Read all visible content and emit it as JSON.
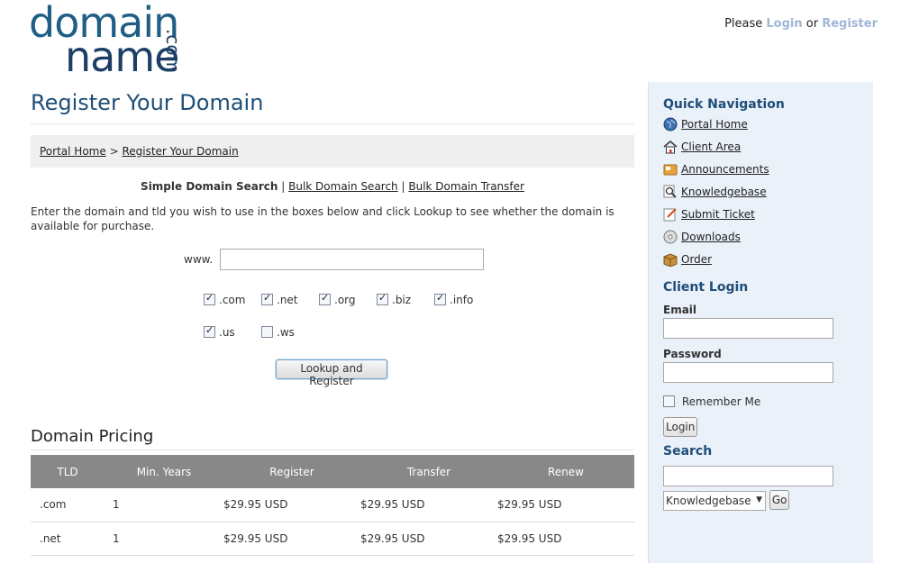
{
  "logo": {
    "line1": "domain",
    "line2": "name",
    "suffix": ".com"
  },
  "top_links": {
    "prefix": "Please",
    "login": "Login",
    "or": "or",
    "register": "Register"
  },
  "page": {
    "title": "Register Your Domain",
    "breadcrumb": {
      "home": "Portal Home",
      "sep": ">",
      "current": "Register Your Domain"
    },
    "search_tabs": {
      "simple": "Simple Domain Search",
      "bulk": "Bulk Domain Search",
      "transfer": "Bulk Domain Transfer",
      "sep": "|"
    },
    "instructions": "Enter the domain and tld you wish to use in the boxes below and click Lookup to see whether the domain is available for purchase.",
    "www_label": "www.",
    "domain_value": "",
    "tlds_row1": [
      {
        "label": ".com",
        "checked": true
      },
      {
        "label": ".net",
        "checked": true
      },
      {
        "label": ".org",
        "checked": true
      },
      {
        "label": ".biz",
        "checked": true
      },
      {
        "label": ".info",
        "checked": true
      }
    ],
    "tlds_row2": [
      {
        "label": ".us",
        "checked": true
      },
      {
        "label": ".ws",
        "checked": false
      }
    ],
    "lookup_button": "Lookup and Register"
  },
  "pricing": {
    "title": "Domain Pricing",
    "headers": [
      "TLD",
      "Min. Years",
      "Register",
      "Transfer",
      "Renew"
    ],
    "rows": [
      [
        ".com",
        "1",
        "$29.95 USD",
        "$29.95 USD",
        "$29.95 USD"
      ],
      [
        ".net",
        "1",
        "$29.95 USD",
        "$29.95 USD",
        "$29.95 USD"
      ]
    ]
  },
  "sidebar": {
    "quick_nav_title": "Quick Navigation",
    "nav": [
      {
        "label": "Portal Home",
        "icon": "globe-icon"
      },
      {
        "label": "Client Area",
        "icon": "house-icon"
      },
      {
        "label": "Announcements",
        "icon": "megaphone-icon"
      },
      {
        "label": "Knowledgebase",
        "icon": "magnifier-icon"
      },
      {
        "label": "Submit Ticket",
        "icon": "note-icon"
      },
      {
        "label": "Downloads",
        "icon": "disc-icon"
      },
      {
        "label": "Order",
        "icon": "box-icon"
      }
    ],
    "login_title": "Client Login",
    "email_label": "Email",
    "password_label": "Password",
    "remember_label": "Remember Me",
    "login_button": "Login",
    "search_title": "Search",
    "search_select": "Knowledgebase",
    "go_button": "Go"
  },
  "colors": {
    "heading": "#1f4e79",
    "link_light": "#9fb6d8",
    "sidebar_bg": "#eaf1f9",
    "table_header": "#888888"
  }
}
